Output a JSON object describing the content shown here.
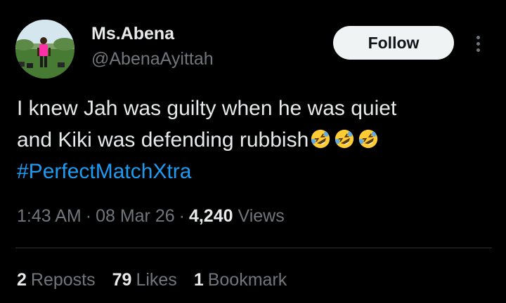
{
  "author": {
    "name": "Ms.Abena",
    "handle": "@AbenaAyittah"
  },
  "follow_label": "Follow",
  "tweet": {
    "line1": "I knew Jah was guilty when he was quiet",
    "line2": "and Kiki was defending rubbish",
    "emojis": [
      "rolling-on-floor-laughing",
      "rolling-on-floor-laughing",
      "rolling-on-floor-laughing"
    ],
    "hashtag": "#PerfectMatchXtra"
  },
  "meta": {
    "time": "1:43 AM",
    "date": "08 Mar 26",
    "views_count": "4,240",
    "views_label": "Views"
  },
  "stats": {
    "reposts_count": "2",
    "reposts_label": "Reposts",
    "likes_count": "79",
    "likes_label": "Likes",
    "bookmarks_count": "1",
    "bookmarks_label": "Bookmark"
  },
  "colors": {
    "background": "#000000",
    "text_primary": "#e7e9ea",
    "text_secondary": "#71767b",
    "link": "#1d9bf0",
    "follow_bg": "#eff3f4",
    "divider": "#2f3336"
  }
}
